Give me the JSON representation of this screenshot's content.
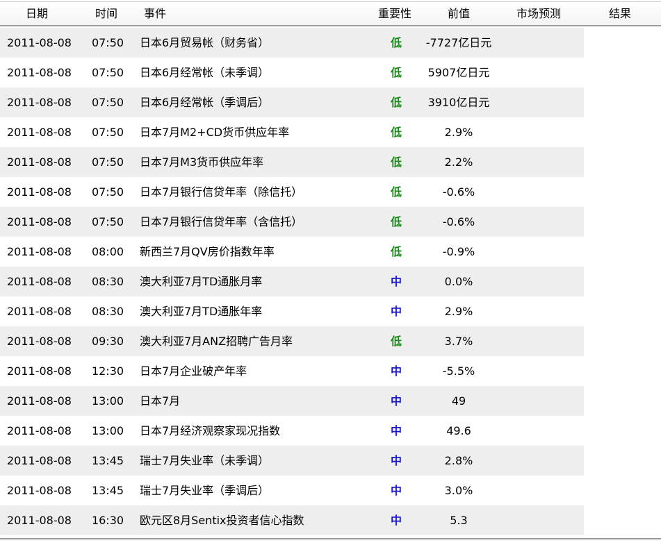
{
  "header": {
    "date": "日期",
    "time": "时间",
    "event": "事件",
    "importance": "重要性",
    "previous": "前值",
    "forecast": "市场预测",
    "result": "结果"
  },
  "colors": {
    "low": "#1a8a1a",
    "medium": "#1a1acc"
  },
  "rows": [
    {
      "date": "2011-08-08",
      "time": "07:50",
      "event": "日本6月贸易帐（财务省）",
      "importance": "低",
      "level": "low",
      "previous": "-7727亿日元"
    },
    {
      "date": "2011-08-08",
      "time": "07:50",
      "event": "日本6月经常帐（未季调）",
      "importance": "低",
      "level": "low",
      "previous": "5907亿日元"
    },
    {
      "date": "2011-08-08",
      "time": "07:50",
      "event": "日本6月经常帐（季调后）",
      "importance": "低",
      "level": "low",
      "previous": "3910亿日元"
    },
    {
      "date": "2011-08-08",
      "time": "07:50",
      "event": "日本7月M2+CD货币供应年率",
      "importance": "低",
      "level": "low",
      "previous": "2.9%"
    },
    {
      "date": "2011-08-08",
      "time": "07:50",
      "event": "日本7月M3货币供应年率",
      "importance": "低",
      "level": "low",
      "previous": "2.2%"
    },
    {
      "date": "2011-08-08",
      "time": "07:50",
      "event": "日本7月银行信贷年率（除信托）",
      "importance": "低",
      "level": "low",
      "previous": "-0.6%"
    },
    {
      "date": "2011-08-08",
      "time": "07:50",
      "event": "日本7月银行信贷年率（含信托）",
      "importance": "低",
      "level": "low",
      "previous": "-0.6%"
    },
    {
      "date": "2011-08-08",
      "time": "08:00",
      "event": "新西兰7月QV房价指数年率",
      "importance": "低",
      "level": "low",
      "previous": "-0.9%"
    },
    {
      "date": "2011-08-08",
      "time": "08:30",
      "event": "澳大利亚7月TD通胀月率",
      "importance": "中",
      "level": "medium",
      "previous": "0.0%"
    },
    {
      "date": "2011-08-08",
      "time": "08:30",
      "event": "澳大利亚7月TD通胀年率",
      "importance": "中",
      "level": "medium",
      "previous": "2.9%"
    },
    {
      "date": "2011-08-08",
      "time": "09:30",
      "event": "澳大利亚7月ANZ招聘广告月率",
      "importance": "低",
      "level": "low",
      "previous": "3.7%"
    },
    {
      "date": "2011-08-08",
      "time": "12:30",
      "event": "日本7月企业破产年率",
      "importance": "中",
      "level": "medium",
      "previous": "-5.5%"
    },
    {
      "date": "2011-08-08",
      "time": "13:00",
      "event": "日本7月",
      "importance": "中",
      "level": "medium",
      "previous": "49"
    },
    {
      "date": "2011-08-08",
      "time": "13:00",
      "event": "日本7月经济观察家现况指数",
      "importance": "中",
      "level": "medium",
      "previous": "49.6"
    },
    {
      "date": "2011-08-08",
      "time": "13:45",
      "event": "瑞士7月失业率（未季调）",
      "importance": "中",
      "level": "medium",
      "previous": "2.8%"
    },
    {
      "date": "2011-08-08",
      "time": "13:45",
      "event": "瑞士7月失业率（季调后）",
      "importance": "中",
      "level": "medium",
      "previous": "3.0%"
    },
    {
      "date": "2011-08-08",
      "time": "16:30",
      "event": "欧元区8月Sentix投资者信心指数",
      "importance": "中",
      "level": "medium",
      "previous": "5.3"
    }
  ]
}
